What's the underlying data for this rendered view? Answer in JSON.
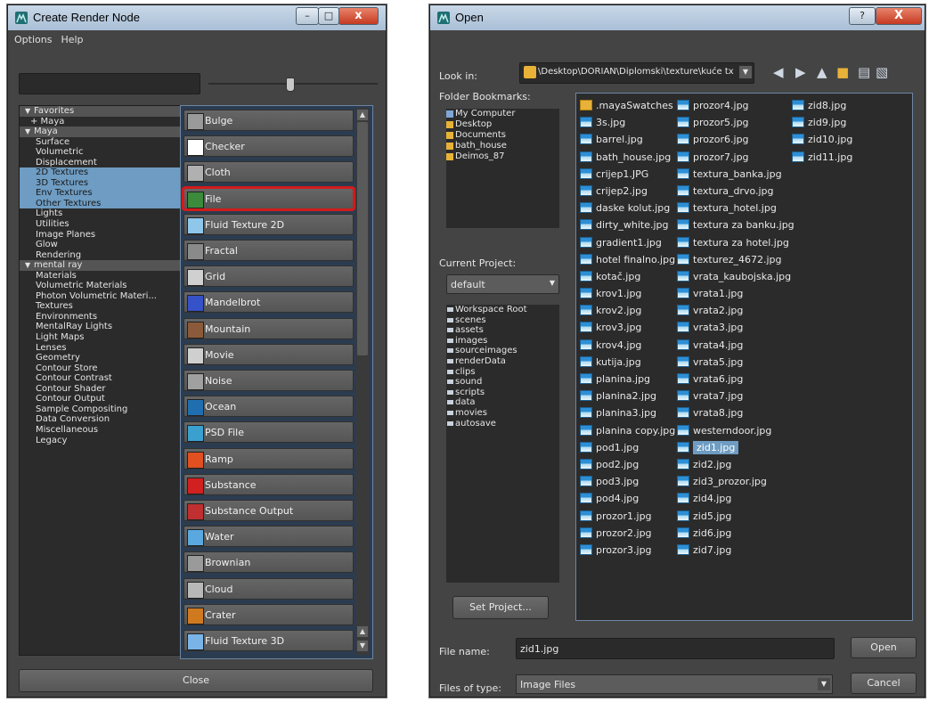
{
  "create_render_node": {
    "title": "Create Render Node",
    "menu": [
      "Options",
      "Help"
    ],
    "tree": [
      {
        "label": "Favorites",
        "kind": "group"
      },
      {
        "label": "+ Maya",
        "kind": "sub"
      },
      {
        "label": "Maya",
        "kind": "group"
      },
      {
        "label": "Surface",
        "kind": "item"
      },
      {
        "label": "Volumetric",
        "kind": "item"
      },
      {
        "label": "Displacement",
        "kind": "item"
      },
      {
        "label": "2D Textures",
        "kind": "sel"
      },
      {
        "label": "3D Textures",
        "kind": "sel"
      },
      {
        "label": "Env Textures",
        "kind": "sel"
      },
      {
        "label": "Other Textures",
        "kind": "sel"
      },
      {
        "label": "Lights",
        "kind": "item"
      },
      {
        "label": "Utilities",
        "kind": "item"
      },
      {
        "label": "Image Planes",
        "kind": "item"
      },
      {
        "label": "Glow",
        "kind": "item"
      },
      {
        "label": "Rendering",
        "kind": "item"
      },
      {
        "label": "mental ray",
        "kind": "group"
      },
      {
        "label": "Materials",
        "kind": "item"
      },
      {
        "label": "Volumetric Materials",
        "kind": "item"
      },
      {
        "label": "Photon Volumetric Materi...",
        "kind": "item"
      },
      {
        "label": "Textures",
        "kind": "item"
      },
      {
        "label": "Environments",
        "kind": "item"
      },
      {
        "label": "MentalRay Lights",
        "kind": "item"
      },
      {
        "label": "Light Maps",
        "kind": "item"
      },
      {
        "label": "Lenses",
        "kind": "item"
      },
      {
        "label": "Geometry",
        "kind": "item"
      },
      {
        "label": "Contour Store",
        "kind": "item"
      },
      {
        "label": "Contour Contrast",
        "kind": "item"
      },
      {
        "label": "Contour Shader",
        "kind": "item"
      },
      {
        "label": "Contour Output",
        "kind": "item"
      },
      {
        "label": "Sample Compositing",
        "kind": "item"
      },
      {
        "label": "Data Conversion",
        "kind": "item"
      },
      {
        "label": "Miscellaneous",
        "kind": "item"
      },
      {
        "label": "Legacy",
        "kind": "item"
      }
    ],
    "nodes": [
      {
        "label": "Bulge",
        "icon": "bulge-icon",
        "color": "#9a9a9a"
      },
      {
        "label": "Checker",
        "icon": "checker-icon",
        "color": "#ffffff"
      },
      {
        "label": "Cloth",
        "icon": "cloth-icon",
        "color": "#b0b0b0"
      },
      {
        "label": "File",
        "icon": "file-icon",
        "color": "#3c8a3c"
      },
      {
        "label": "Fluid Texture 2D",
        "icon": "fluid-2d-icon",
        "color": "#8fc7ea"
      },
      {
        "label": "Fractal",
        "icon": "fractal-icon",
        "color": "#8a8a8a"
      },
      {
        "label": "Grid",
        "icon": "grid-icon",
        "color": "#d0d0d0"
      },
      {
        "label": "Mandelbrot",
        "icon": "mandelbrot-icon",
        "color": "#3552c8"
      },
      {
        "label": "Mountain",
        "icon": "mountain-icon",
        "color": "#8b5a3a"
      },
      {
        "label": "Movie",
        "icon": "movie-icon",
        "color": "#cfcfcf"
      },
      {
        "label": "Noise",
        "icon": "noise-icon",
        "color": "#a0a0a0"
      },
      {
        "label": "Ocean",
        "icon": "ocean-icon",
        "color": "#1f6fb0"
      },
      {
        "label": "PSD File",
        "icon": "psd-file-icon",
        "color": "#3aa0d0"
      },
      {
        "label": "Ramp",
        "icon": "ramp-icon",
        "color": "#e05020"
      },
      {
        "label": "Substance",
        "icon": "substance-icon",
        "color": "#d02020"
      },
      {
        "label": "Substance Output",
        "icon": "substance-output-icon",
        "color": "#c03030"
      },
      {
        "label": "Water",
        "icon": "water-icon",
        "color": "#5aa8e0"
      },
      {
        "label": "Brownian",
        "icon": "brownian-icon",
        "color": "#9a9a9a"
      },
      {
        "label": "Cloud",
        "icon": "cloud-icon",
        "color": "#b8b8b8"
      },
      {
        "label": "Crater",
        "icon": "crater-icon",
        "color": "#d07a20"
      },
      {
        "label": "Fluid Texture 3D",
        "icon": "fluid-3d-icon",
        "color": "#7ab4e6"
      }
    ],
    "highlighted_node": "File",
    "close_label": "Close"
  },
  "open_dialog": {
    "title": "Open",
    "help_label": "?",
    "close_label": "X",
    "look_in_label": "Look in:",
    "look_in_path": "\\Desktop\\DORIAN\\Diplomski\\texture\\kuće tx",
    "folder_bookmarks_label": "Folder Bookmarks:",
    "bookmarks": [
      "My Computer",
      "Desktop",
      "Documents",
      "bath_house",
      "Deimos_87"
    ],
    "current_project_label": "Current Project:",
    "current_project": "default",
    "workspace": [
      "Workspace Root",
      "scenes",
      "assets",
      "images",
      "sourceimages",
      "renderData",
      "clips",
      "sound",
      "scripts",
      "data",
      "movies",
      "autosave"
    ],
    "set_project_label": "Set Project...",
    "files_col1": [
      ".mayaSwatches",
      "3s.jpg",
      "barrel.jpg",
      "bath_house.jpg",
      "crijep1.JPG",
      "crijep2.jpg",
      "daske kolut.jpg",
      "dirty_white.jpg",
      "gradient1.jpg",
      "hotel finalno.jpg",
      "kotač.jpg",
      "krov1.jpg",
      "krov2.jpg",
      "krov3.jpg",
      "krov4.jpg",
      "kutija.jpg",
      "planina.jpg",
      "planina2.jpg",
      "planina3.jpg",
      "planina copy.jpg",
      "pod1.jpg",
      "pod2.jpg",
      "pod3.jpg",
      "pod4.jpg",
      "prozor1.jpg",
      "prozor2.jpg",
      "prozor3.jpg"
    ],
    "files_col2": [
      "prozor4.jpg",
      "prozor5.jpg",
      "prozor6.jpg",
      "prozor7.jpg",
      "textura_banka.jpg",
      "textura_drvo.jpg",
      "textura_hotel.jpg",
      "textura za banku.jpg",
      "textura za hotel.jpg",
      "texturez_4672.jpg",
      "vrata_kaubojska.jpg",
      "vrata1.jpg",
      "vrata2.jpg",
      "vrata3.jpg",
      "vrata4.jpg",
      "vrata5.jpg",
      "vrata6.jpg",
      "vrata7.jpg",
      "vrata8.jpg",
      "westerndoor.jpg",
      "zid1.jpg",
      "zid2.jpg",
      "zid3_prozor.jpg",
      "zid4.jpg",
      "zid5.jpg",
      "zid6.jpg",
      "zid7.jpg"
    ],
    "files_col3": [
      "zid8.jpg",
      "zid9.jpg",
      "zid10.jpg",
      "zid11.jpg"
    ],
    "selected_file": "zid1.jpg",
    "file_name_label": "File name:",
    "file_name_value": "zid1.jpg",
    "open_label": "Open",
    "files_of_type_label": "Files of type:",
    "files_of_type_value": "Image Files",
    "cancel_label": "Cancel"
  },
  "colors": {
    "window_bg": "#444444",
    "list_bg": "#2b2b2b",
    "selection": "#6e9cc2",
    "highlight_outline": "#d21b1b"
  }
}
